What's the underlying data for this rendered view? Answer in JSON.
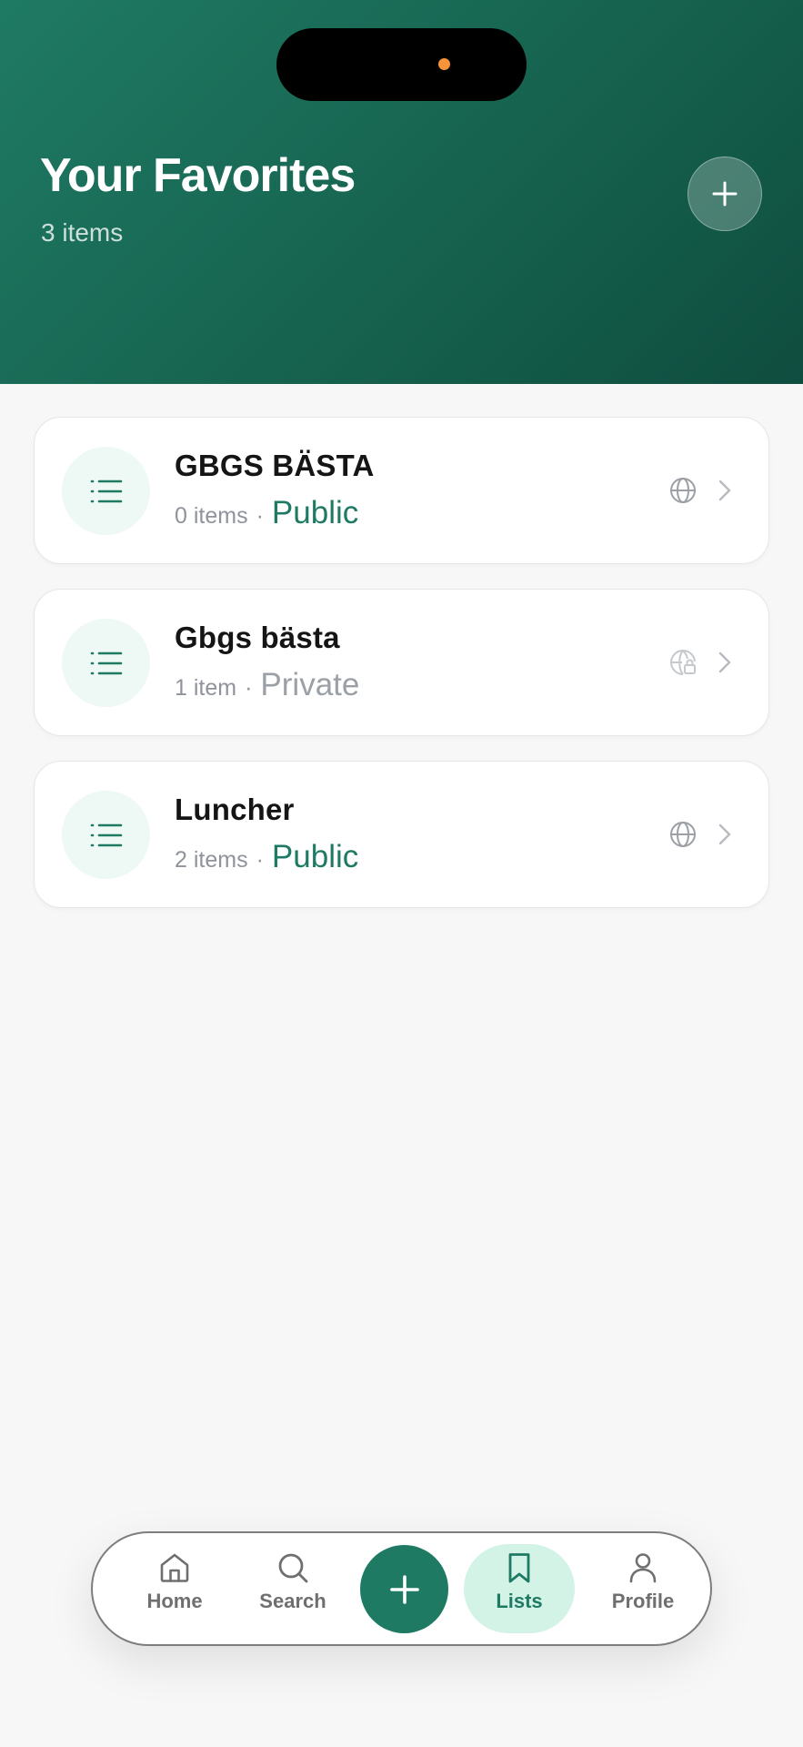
{
  "header": {
    "title": "Your Favorites",
    "subtitle": "3 items",
    "add_icon": "plus-icon"
  },
  "lists": [
    {
      "title": "GBGS BÄSTA",
      "count": "0 items",
      "separator": "·",
      "visibility": "Public",
      "icon": "list-icon",
      "visibility_icon": "globe-icon"
    },
    {
      "title": "Gbgs bästa",
      "count": "1 item",
      "separator": "·",
      "visibility": "Private",
      "icon": "list-icon",
      "visibility_icon": "globe-lock-icon"
    },
    {
      "title": "Luncher",
      "count": "2 items",
      "separator": "·",
      "visibility": "Public",
      "icon": "list-icon",
      "visibility_icon": "globe-icon"
    }
  ],
  "tabbar": {
    "home": "Home",
    "search": "Search",
    "lists": "Lists",
    "profile": "Profile",
    "active": "Lists"
  },
  "colors": {
    "brand": "#1f7a64",
    "header_gradient_start": "#1f7a64",
    "header_gradient_end": "#0f4d3f",
    "active_tab_bg": "#d3f3e7",
    "muted_text": "#8f939b"
  }
}
